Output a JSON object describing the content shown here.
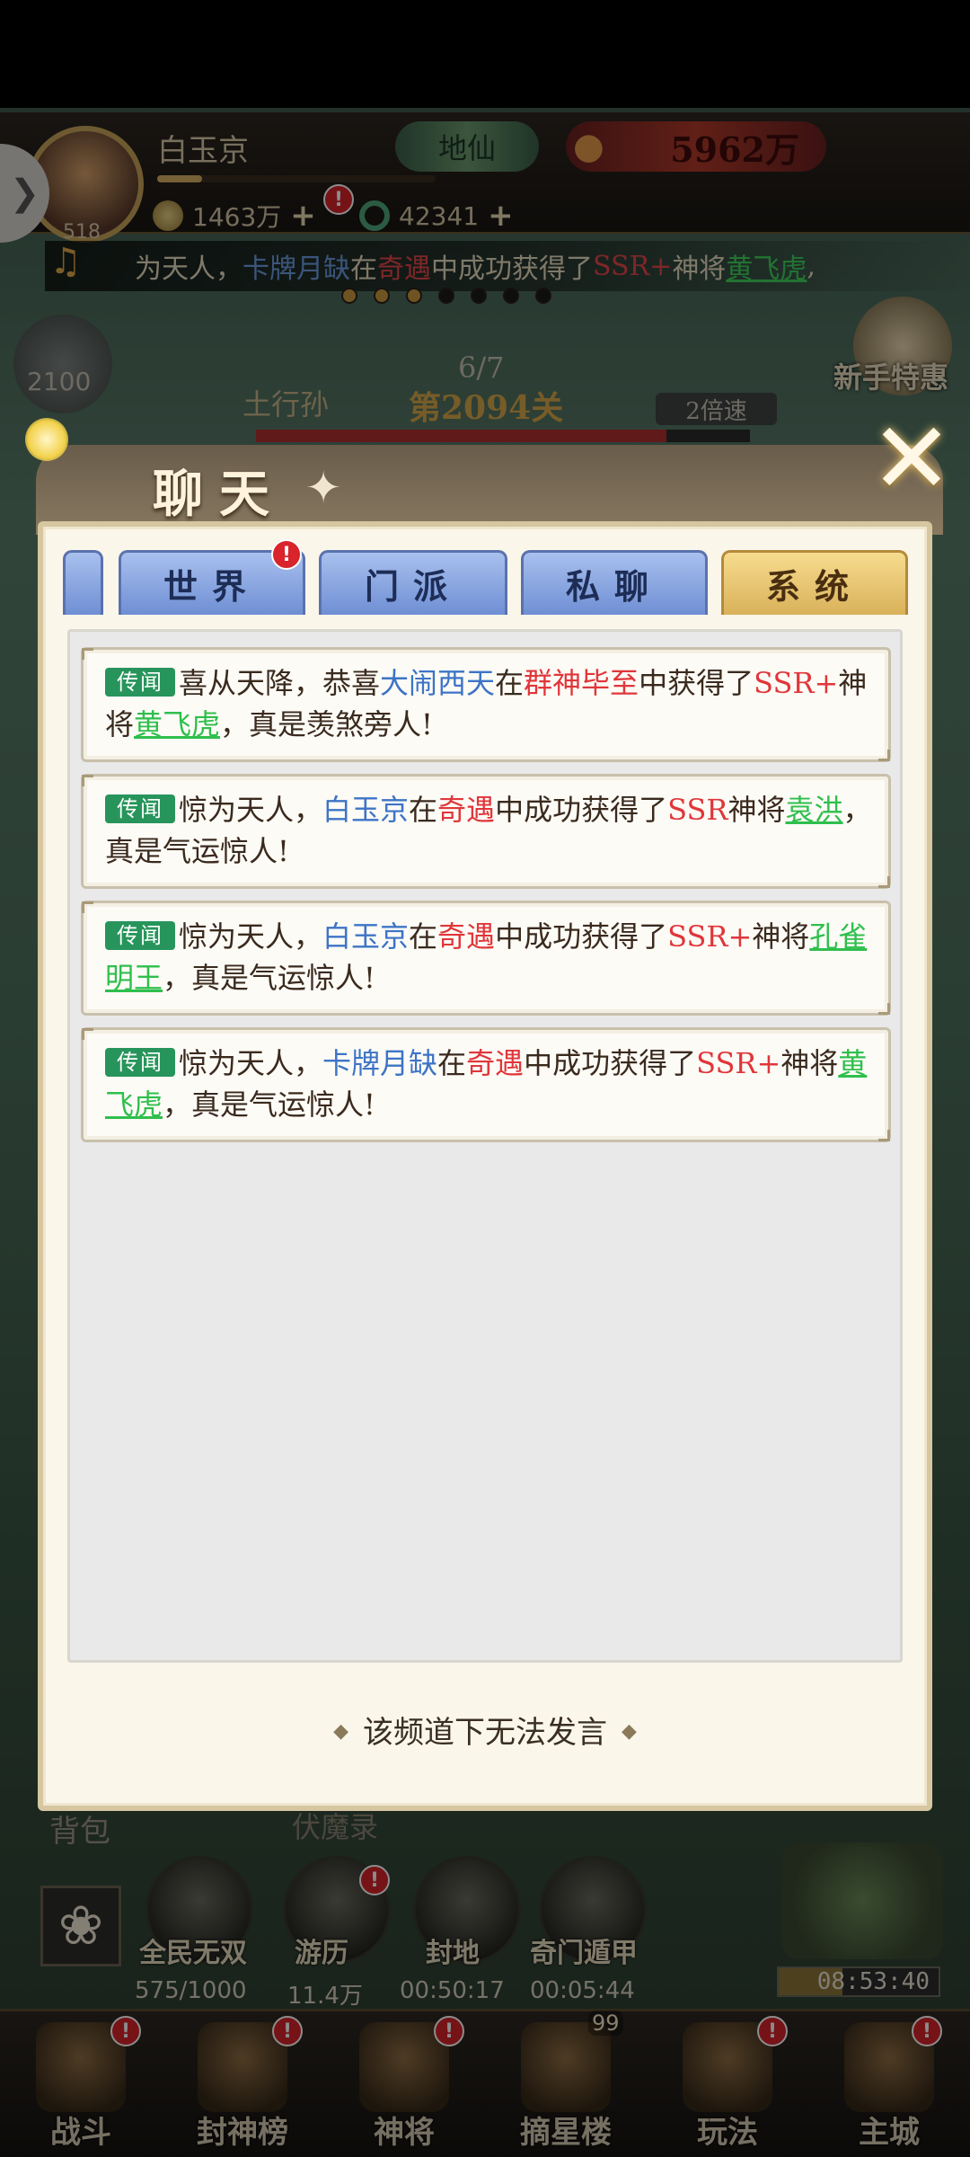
{
  "player": {
    "name": "白玉京",
    "level": "518",
    "rank": "地仙",
    "power": "5962万",
    "exp_fraction": 0.16,
    "gold": "1463万",
    "jade": "42341"
  },
  "ticker": {
    "prefix": "为天人，",
    "name": "卡牌月缺",
    "in": "在",
    "event": "奇遇",
    "mid": "中成功获得了",
    "rarity": "SSR+",
    "general_word": "神将",
    "general": "黄飞虎",
    "suffix": ","
  },
  "stage": {
    "enemy": "土行孙",
    "count": "6/7",
    "level": "第2094关",
    "speed": "2倍速",
    "left_count": "2100",
    "newbie_label": "新手特惠",
    "progress_fraction": 0.83
  },
  "chat": {
    "title": "聊天",
    "tabs": [
      {
        "label": "世界"
      },
      {
        "label": "门派"
      },
      {
        "label": "私聊"
      },
      {
        "label": "系统"
      }
    ],
    "messages": [
      {
        "tag": "传闻",
        "parts": [
          {
            "t": "喜从天降，恭喜",
            "c": ""
          },
          {
            "t": "大闹西天",
            "c": "c-blue"
          },
          {
            "t": "在",
            "c": ""
          },
          {
            "t": "群神毕至",
            "c": "c-red"
          },
          {
            "t": "中获得了",
            "c": ""
          },
          {
            "t": "SSR+",
            "c": "c-red"
          },
          {
            "t": "神将",
            "c": ""
          },
          {
            "t": "黄飞虎",
            "c": "c-green"
          },
          {
            "t": "，真是羡煞旁人!",
            "c": ""
          }
        ]
      },
      {
        "tag": "传闻",
        "parts": [
          {
            "t": "惊为天人，",
            "c": ""
          },
          {
            "t": "白玉京",
            "c": "c-blue"
          },
          {
            "t": "在",
            "c": ""
          },
          {
            "t": "奇遇",
            "c": "c-red"
          },
          {
            "t": "中成功获得了",
            "c": ""
          },
          {
            "t": "SSR",
            "c": "c-red"
          },
          {
            "t": "神将",
            "c": ""
          },
          {
            "t": "袁洪",
            "c": "c-green"
          },
          {
            "t": "，真是气运惊人!",
            "c": ""
          }
        ]
      },
      {
        "tag": "传闻",
        "parts": [
          {
            "t": "惊为天人，",
            "c": ""
          },
          {
            "t": "白玉京",
            "c": "c-blue"
          },
          {
            "t": "在",
            "c": ""
          },
          {
            "t": "奇遇",
            "c": "c-red"
          },
          {
            "t": "中成功获得了",
            "c": ""
          },
          {
            "t": "SSR+",
            "c": "c-red"
          },
          {
            "t": "神将",
            "c": ""
          },
          {
            "t": "孔雀明王",
            "c": "c-green"
          },
          {
            "t": "，真是气运惊人!",
            "c": ""
          }
        ]
      },
      {
        "tag": "传闻",
        "parts": [
          {
            "t": "惊为天人，",
            "c": ""
          },
          {
            "t": "卡牌月缺",
            "c": "c-blue"
          },
          {
            "t": "在",
            "c": ""
          },
          {
            "t": "奇遇",
            "c": "c-red"
          },
          {
            "t": "中成功获得了",
            "c": ""
          },
          {
            "t": "SSR+",
            "c": "c-red"
          },
          {
            "t": "神将",
            "c": ""
          },
          {
            "t": "黄飞虎",
            "c": "c-green"
          },
          {
            "t": "，真是气运惊人!",
            "c": ""
          }
        ]
      }
    ],
    "footer": "该频道下无法发言"
  },
  "bottom": {
    "bag_label": "背包",
    "fumo_label": "伏魔录",
    "shortcuts": [
      {
        "label": "全民无双",
        "value": "575/1000"
      },
      {
        "label": "游历",
        "value": "11.4万"
      },
      {
        "label": "封地",
        "value": "00:50:17"
      },
      {
        "label": "奇门遁甲",
        "value": "00:05:44"
      }
    ],
    "timer": "08:53:40",
    "nav": [
      {
        "label": "战斗"
      },
      {
        "label": "封神榜"
      },
      {
        "label": "神将"
      },
      {
        "label": "摘星楼",
        "count": "99"
      },
      {
        "label": "玩法"
      },
      {
        "label": "主城"
      }
    ]
  },
  "colors": {
    "tab_inactive": "#7f9ddb",
    "tab_active": "#e9c774",
    "tag_green": "#27955b",
    "highlight_blue": "#3d74c6",
    "highlight_red": "#e0363a",
    "highlight_green": "#2fbf4c"
  }
}
